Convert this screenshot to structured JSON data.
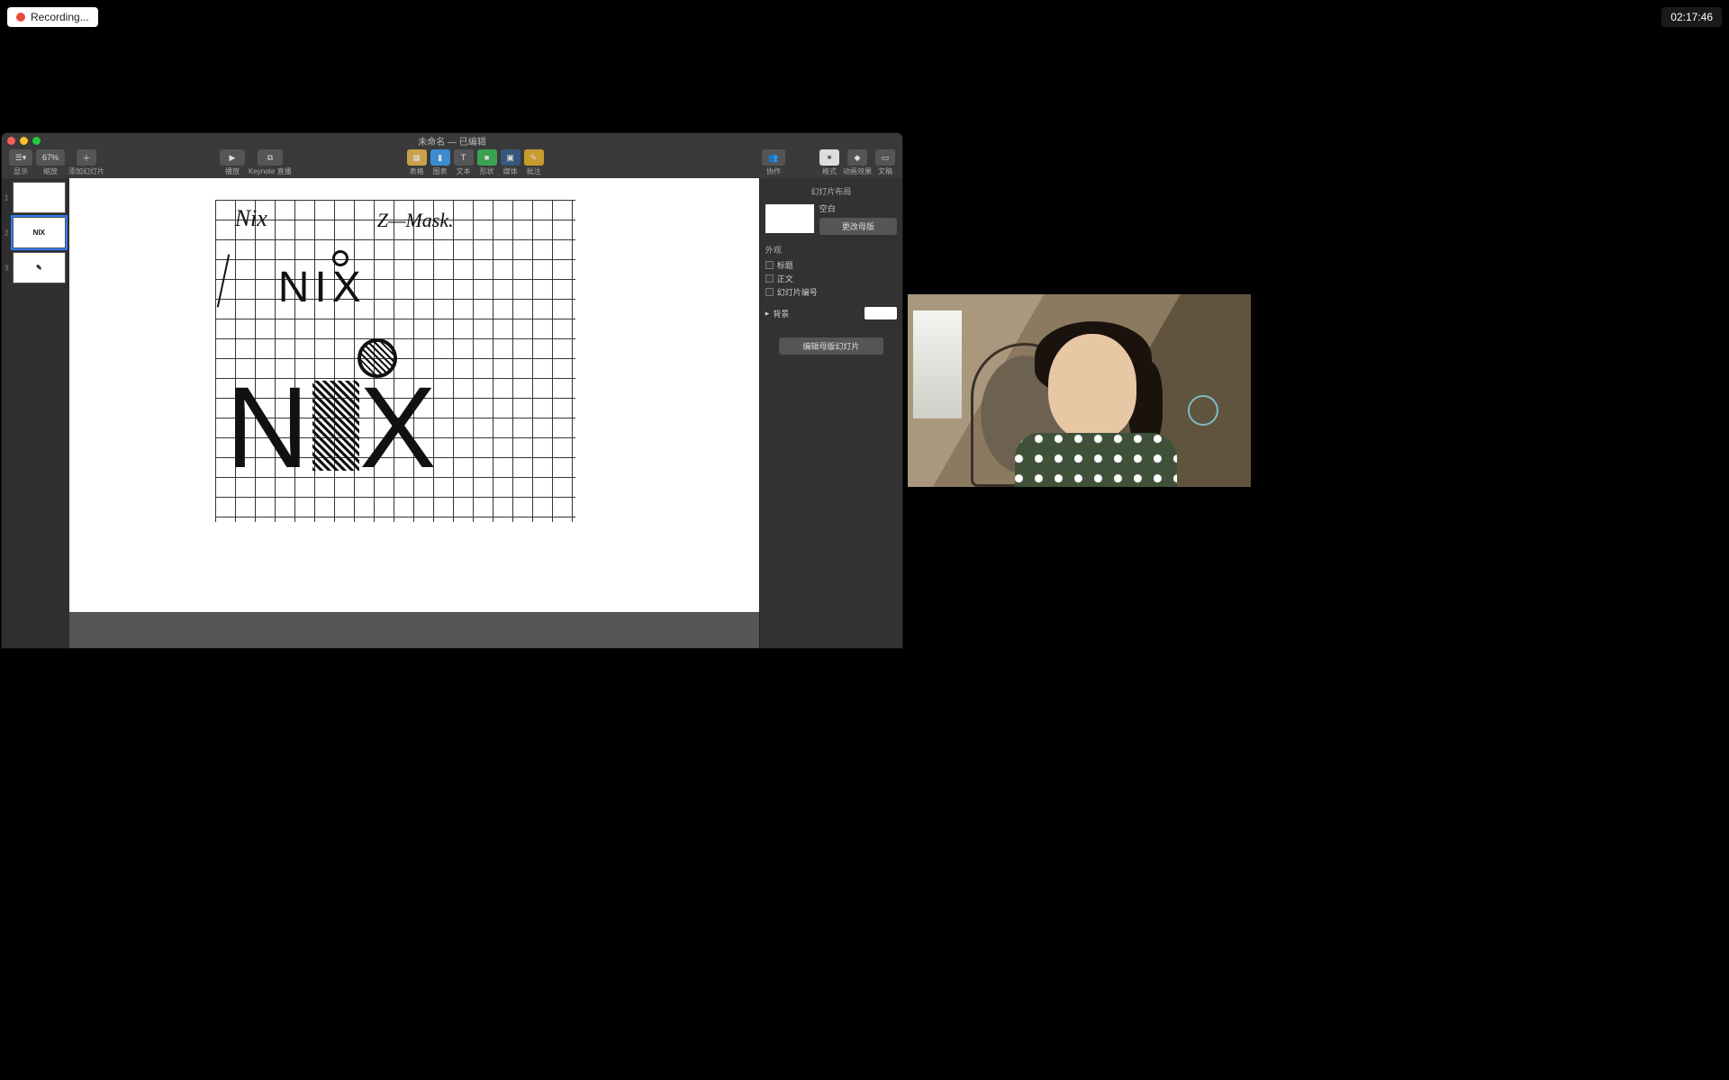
{
  "recording": {
    "label": "Recording..."
  },
  "timer": {
    "value": "02:17:46"
  },
  "window": {
    "title": "未命名 — 已编辑"
  },
  "toolbar": {
    "view": "显示",
    "zoom": "67%",
    "zoom_label": "缩放",
    "add_slide": "添加幻灯片",
    "play": "播放",
    "keynote_live": "Keynote 直播",
    "table": "表格",
    "chart": "图表",
    "text": "文本",
    "shape": "形状",
    "media": "媒体",
    "comment": "批注",
    "collaborate": "协作",
    "format": "格式",
    "animate": "动画效果",
    "document": "文稿"
  },
  "thumbnails": [
    {
      "num": "1",
      "label": ""
    },
    {
      "num": "2",
      "label": "NIX"
    },
    {
      "num": "3",
      "label": "✎"
    }
  ],
  "slide_sketch": {
    "small_note_left": "Nix",
    "small_note_right": "Z—Mask.",
    "mid_word": "NIX",
    "big_word": "NIX"
  },
  "inspector": {
    "header": "幻灯片布局",
    "layout_name": "空白",
    "change_master": "更改母版",
    "appearance": "外观",
    "title_cb": "标题",
    "body_cb": "正文",
    "number_cb": "幻灯片编号",
    "background": "背景",
    "edit_master": "编辑母版幻灯片"
  }
}
